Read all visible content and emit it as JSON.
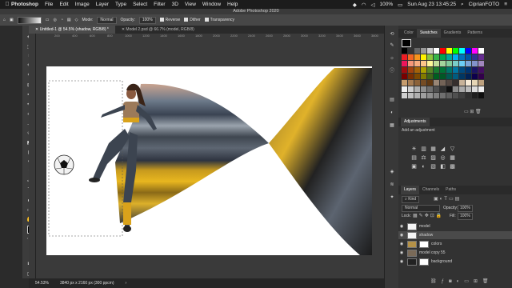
{
  "menubar": {
    "apple": "",
    "app_name": "Photoshop",
    "items": [
      "File",
      "Edit",
      "Image",
      "Layer",
      "Type",
      "Select",
      "Filter",
      "3D",
      "View",
      "Window",
      "Help"
    ],
    "battery": "100%",
    "clock": "Sun Aug 23  13:45:25",
    "user": "CiprianFOTO"
  },
  "window": {
    "title": "Adobe Photoshop 2020"
  },
  "options_bar": {
    "mode_label": "Mode:",
    "mode_value": "Normal",
    "opacity_label": "Opacity:",
    "opacity_value": "100%",
    "reverse_label": "Reverse",
    "dither_label": "Dither",
    "transparency_label": "Transparency"
  },
  "doc_tabs": [
    {
      "label": "Untitled-1 @ 54.5% (shadow, RGB/8) *",
      "active": true
    },
    {
      "label": "Model 2.psd @ 66.7% (model, RGB/8)",
      "active": false
    }
  ],
  "ruler_labels": [
    "200",
    "400",
    "600",
    "800",
    "1000",
    "1200",
    "1400",
    "1600",
    "1800",
    "2000",
    "2200",
    "2400",
    "2600",
    "2800",
    "3000",
    "3200",
    "3400",
    "3600",
    "3800"
  ],
  "status_bar": {
    "zoom": "54.53%",
    "doc_size": "3840 px x 2160 px (300 ppcm)"
  },
  "swatches_panel": {
    "tabs": [
      "Color",
      "Swatches",
      "Gradients",
      "Patterns"
    ],
    "active_tab": "Swatches"
  },
  "adjustments_panel": {
    "tabs": [
      "Adjustments"
    ],
    "add_label": "Add an adjustment",
    "icons": [
      "☀",
      "▥",
      "▦",
      "◢",
      "▽",
      "▤",
      "⚖",
      "▨",
      "◎",
      "▦",
      "▣",
      "◐",
      "▧",
      "◧",
      "▩"
    ]
  },
  "layers_panel": {
    "tabs": [
      "Layers",
      "Channels",
      "Paths"
    ],
    "kind_label": "Kind",
    "blend_mode": "Normal",
    "opacity_label": "Opacity:",
    "opacity_value": "100%",
    "lock_label": "Lock:",
    "fill_label": "Fill:",
    "fill_value": "100%",
    "layers": [
      {
        "name": "model",
        "selected": false,
        "has_mask": false
      },
      {
        "name": "shadow",
        "selected": true,
        "has_mask": false
      },
      {
        "name": "colors",
        "selected": false,
        "has_mask": true
      },
      {
        "name": "model copy 55",
        "selected": false,
        "has_mask": false
      },
      {
        "name": "background",
        "selected": false,
        "has_mask": true
      }
    ]
  },
  "swatch_colors": [
    "#000000",
    "#333333",
    "#666666",
    "#999999",
    "#cccccc",
    "#ffffff",
    "#ff0000",
    "#ffff00",
    "#00ff00",
    "#00ffff",
    "#0000ff",
    "#ff00ff",
    "#ffffff",
    "#ed1c24",
    "#f26522",
    "#f7941d",
    "#fff200",
    "#8dc63f",
    "#39b54a",
    "#00a651",
    "#00a99d",
    "#00aeef",
    "#0072bc",
    "#0054a6",
    "#2e3192",
    "#662d91",
    "#ed145b",
    "#f69679",
    "#f9ad81",
    "#fdc689",
    "#fff799",
    "#c4df9b",
    "#a3d39c",
    "#82ca9c",
    "#7accc8",
    "#6dcff6",
    "#7da7d9",
    "#8393ca",
    "#a187be",
    "#9e0b0f",
    "#a0410d",
    "#a36209",
    "#aba000",
    "#598527",
    "#1a7b30",
    "#007236",
    "#00746b",
    "#0076a3",
    "#004a80",
    "#003471",
    "#1b1464",
    "#440e62",
    "#790000",
    "#7b2e00",
    "#7d4900",
    "#827b00",
    "#406618",
    "#005e20",
    "#005826",
    "#005952",
    "#005b7f",
    "#003663",
    "#002157",
    "#0d004c",
    "#32004b",
    "#c69c6d",
    "#a67c52",
    "#8c6239",
    "#754c24",
    "#603913",
    "#998675",
    "#736357",
    "#534741",
    "#362f2d",
    "#c7b299",
    "#f5e9d6",
    "#e5d5b5",
    "#bda17f",
    "#f0f0f0",
    "#d0d0d0",
    "#b0b0b0",
    "#909090",
    "#707070",
    "#505050",
    "#303030",
    "#101010",
    "#8a8a8a",
    "#aaaaaa",
    "#bbbbbb",
    "#dddddd",
    "#eeeeee",
    "#cfcfcf",
    "#bfbfbf",
    "#afafaf",
    "#9f9f9f",
    "#8f8f8f",
    "#7f7f7f",
    "#6f6f6f",
    "#5f5f5f",
    "#4f4f4f",
    "#3f3f3f",
    "#2f2f2f",
    "#1f1f1f",
    "#0f0f0f"
  ]
}
